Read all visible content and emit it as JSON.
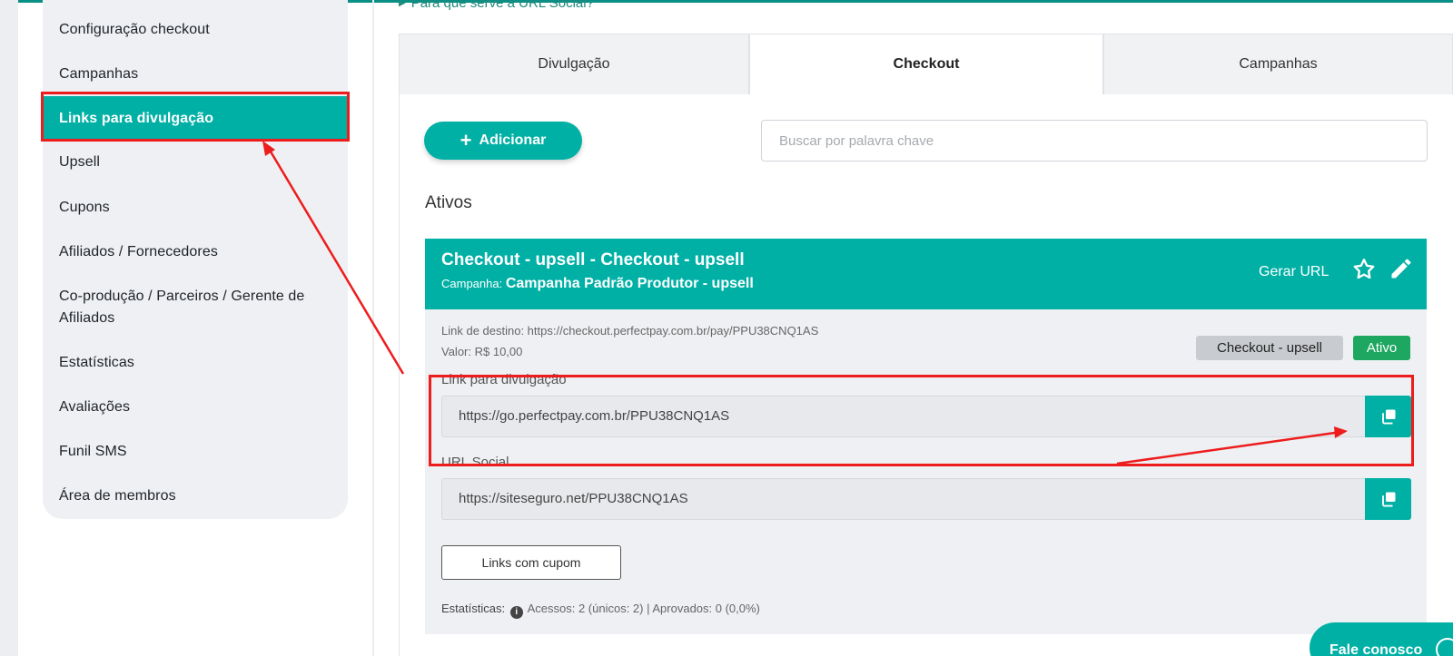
{
  "sidebar": {
    "items": [
      {
        "label": "Configuração checkout"
      },
      {
        "label": "Campanhas"
      },
      {
        "label": "Links para divulgação",
        "active": true
      },
      {
        "label": "Upsell"
      },
      {
        "label": "Cupons"
      },
      {
        "label": "Afiliados / Fornecedores"
      },
      {
        "label": "Co-produção / Parceiros / Gerente de Afiliados"
      },
      {
        "label": "Estatísticas"
      },
      {
        "label": "Avaliações"
      },
      {
        "label": "Funil SMS"
      },
      {
        "label": "Área de membros"
      }
    ]
  },
  "help_link": "Para que serve a URL Social?",
  "tabs": [
    {
      "label": "Divulgação"
    },
    {
      "label": "Checkout",
      "active": true
    },
    {
      "label": "Campanhas"
    }
  ],
  "toolbar": {
    "add_label": "Adicionar",
    "search_placeholder": "Buscar por palavra chave"
  },
  "section_title": "Ativos",
  "card": {
    "title": "Checkout - upsell - Checkout - upsell",
    "campaign_prefix": "Campanha:",
    "campaign_name": "Campanha Padrão Produtor - upsell",
    "gerar_url": "Gerar URL",
    "link_destino": "Link de destino: https://checkout.perfectpay.com.br/pay/PPU38CNQ1AS",
    "valor": "Valor: R$ 10,00",
    "badge_checkout": "Checkout - upsell",
    "badge_status": "Ativo",
    "link_divulgacao_label": "Link para divulgação",
    "link_divulgacao_value": "https://go.perfectpay.com.br/PPU38CNQ1AS",
    "url_social_label": "URL Social",
    "url_social_value": "https://siteseguro.net/PPU38CNQ1AS",
    "cupom_button": "Links com cupom",
    "stats_label": "Estatísticas:",
    "stats_text": "Acessos: 2 (únicos: 2) | Aprovados: 0 (0,0%)"
  },
  "chat": {
    "label": "Fale conosco"
  },
  "colors": {
    "accent": "#00b0a5",
    "annotation": "#ee1c1c",
    "status_green": "#1ea760"
  }
}
